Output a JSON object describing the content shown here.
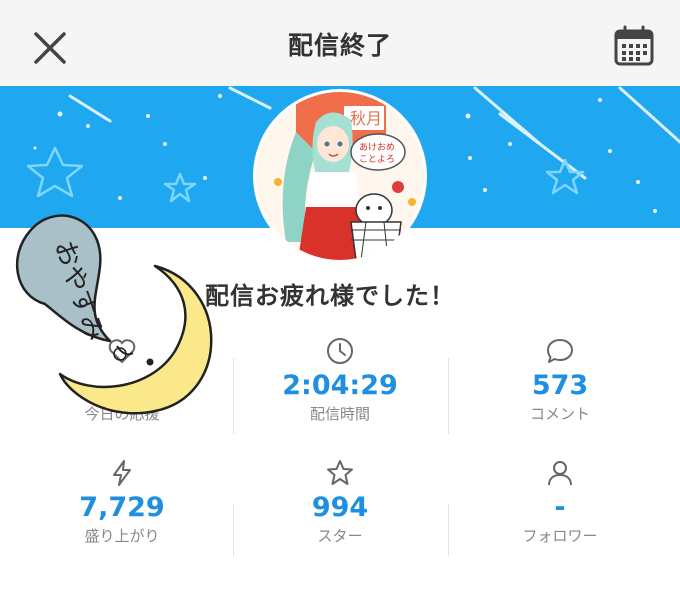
{
  "header": {
    "title": "配信終了",
    "close_icon": "close-icon",
    "calendar_icon": "calendar-icon"
  },
  "colors": {
    "banner": "#1fa7f0",
    "accent_value": "#1e8fe1",
    "header_bg": "#f5f5f5"
  },
  "avatar": {
    "sign_top": "秋月",
    "sign_bubble_line1": "あけおめ",
    "sign_bubble_line2": "ことよろ"
  },
  "end_message": "配信お疲れ様でした！",
  "sticker": {
    "text": "おやすみ"
  },
  "stats": [
    {
      "icon": "heart-icon",
      "value": "",
      "label": "今日の応援"
    },
    {
      "icon": "clock-icon",
      "value": "2:04:29",
      "label": "配信時間"
    },
    {
      "icon": "comment-icon",
      "value": "573",
      "label": "コメント"
    },
    {
      "icon": "lightning-icon",
      "value": "7,729",
      "label": "盛り上がり"
    },
    {
      "icon": "star-icon",
      "value": "994",
      "label": "スター"
    },
    {
      "icon": "person-icon",
      "value": "-",
      "label": "フォロワー"
    }
  ]
}
